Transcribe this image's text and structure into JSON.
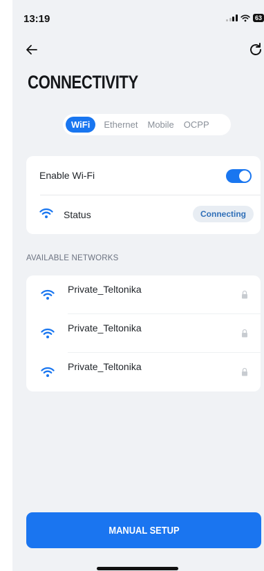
{
  "status_bar": {
    "time": "13:19",
    "battery": "63"
  },
  "header": {
    "title": "CONNECTIVITY"
  },
  "tabs": [
    {
      "label": "WiFi",
      "active": true
    },
    {
      "label": "Ethernet",
      "active": false
    },
    {
      "label": "Mobile",
      "active": false
    },
    {
      "label": "OCPP",
      "active": false
    }
  ],
  "wifi_card": {
    "enable_label": "Enable Wi-Fi",
    "enabled": true,
    "status_label": "Status",
    "status_value": "Connecting"
  },
  "networks": {
    "heading": "AVAILABLE NETWORKS",
    "items": [
      {
        "name": "Private_Teltonika",
        "secured": true
      },
      {
        "name": "Private_Teltonika",
        "secured": true
      },
      {
        "name": "Private_Teltonika",
        "secured": true
      }
    ]
  },
  "footer": {
    "manual_setup_label": "MANUAL SETUP"
  },
  "colors": {
    "accent": "#1976f0",
    "background": "#f0f2f5",
    "card": "#ffffff",
    "badge_text": "#2f6fb8"
  },
  "icons": {
    "back": "arrow-left-icon",
    "refresh": "refresh-icon",
    "wifi": "wifi-icon",
    "lock": "lock-icon"
  }
}
